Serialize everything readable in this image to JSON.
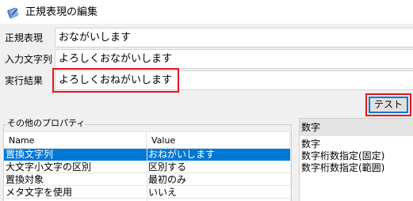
{
  "window": {
    "title": "正規表現の編集",
    "icon": "app-icon"
  },
  "fields": [
    {
      "label": "正規表現",
      "value": "おながいします"
    },
    {
      "label": "入力文字列",
      "value": "よろしくおながいします"
    },
    {
      "label": "実行結果",
      "value": "よろしくおねがいします"
    }
  ],
  "test_button": "テスト",
  "properties": {
    "group_title": "その他のプロパティ",
    "columns": [
      "Name",
      "Value"
    ],
    "rows": [
      {
        "name": "置換文字列",
        "value": "おねがいします",
        "selected": true
      },
      {
        "name": "大文字小文字の区別",
        "value": "区別する",
        "selected": false
      },
      {
        "name": "置換対象",
        "value": "最初のみ",
        "selected": false
      },
      {
        "name": "メタ文字を使用",
        "value": "いいえ",
        "selected": false
      }
    ]
  },
  "pattern_list": {
    "header": "数字",
    "items": [
      "数字",
      "数字桁数指定(固定)",
      "数字桁数指定(範囲)"
    ]
  },
  "colors": {
    "highlight": "#e8141c",
    "selection": "#0078d7",
    "focus_border": "#0078d7"
  }
}
